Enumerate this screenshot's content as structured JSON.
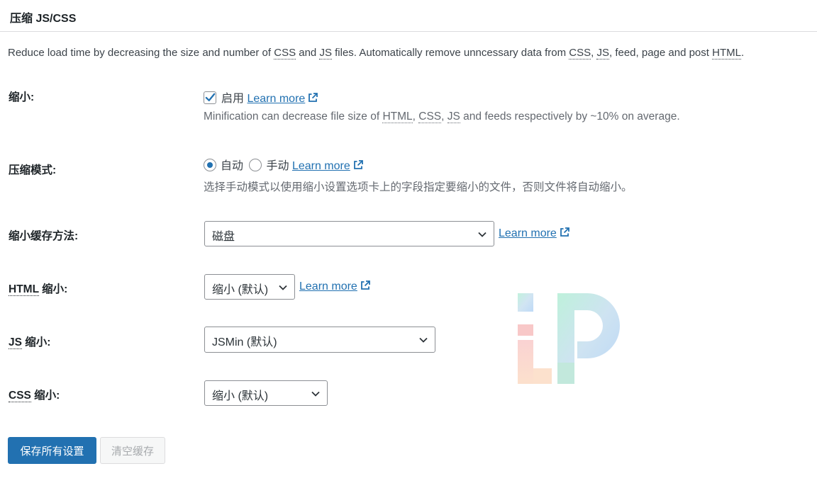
{
  "header": {
    "title": "压缩 JS/CSS"
  },
  "intro": {
    "p1": "Reduce load time by decreasing the size and number of ",
    "css1": "CSS",
    "p2": " and ",
    "js1": "JS",
    "p3": " files. Automatically remove unncessary data from ",
    "css2": "CSS",
    "p4": ", ",
    "js2": "JS",
    "p5": ", feed, page and post ",
    "html1": "HTML",
    "p6": "."
  },
  "minify": {
    "label": "缩小:",
    "checkbox_label": "启用",
    "checked": true,
    "learn_more": "Learn more",
    "desc": {
      "d1": "Minification can decrease file size of ",
      "html": "HTML",
      "d2": ", ",
      "css": "CSS",
      "d3": ", ",
      "js": "JS",
      "d4": " and feeds respectively by ~10% on average."
    }
  },
  "mode": {
    "label": "压缩模式:",
    "options": [
      "自动",
      "手动"
    ],
    "selected": "自动",
    "learn_more": "Learn more",
    "desc": "选择手动模式以使用缩小设置选项卡上的字段指定要缩小的文件，否则文件将自动缩小。"
  },
  "cache_method": {
    "label": "缩小缓存方法:",
    "value": "磁盘",
    "learn_more": "Learn more"
  },
  "html_minify": {
    "label_abbr": "HTML",
    "label_rest": " 缩小:",
    "value": "缩小 (默认)",
    "learn_more": "Learn more"
  },
  "js_minify": {
    "label_abbr": "JS",
    "label_rest": " 缩小:",
    "value": "JSMin (默认)"
  },
  "css_minify": {
    "label_abbr": "CSS",
    "label_rest": " 缩小:",
    "value": "缩小 (默认)"
  },
  "buttons": {
    "save_all": "保存所有设置",
    "clear_cache": "清空缓存"
  },
  "colors": {
    "accent": "#2271b1",
    "text": "#1d2327",
    "muted": "#646970"
  }
}
